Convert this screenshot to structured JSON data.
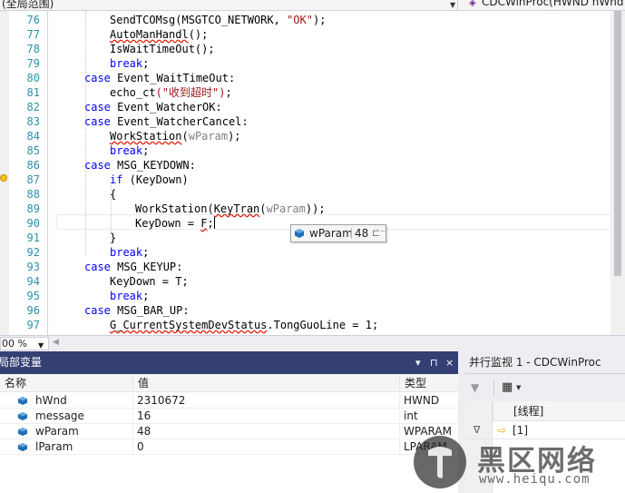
{
  "scope_bar": {
    "left": "(全局范围)",
    "right": "CDCWinProc(HWND hWnd"
  },
  "code_lines": [
    {
      "n": "76"
    },
    {
      "n": "77"
    },
    {
      "n": "78"
    },
    {
      "n": "79"
    },
    {
      "n": "80"
    },
    {
      "n": "81"
    },
    {
      "n": "82"
    },
    {
      "n": "83"
    },
    {
      "n": "84"
    },
    {
      "n": "85"
    },
    {
      "n": "86"
    },
    {
      "n": "87"
    },
    {
      "n": "88"
    },
    {
      "n": "89"
    },
    {
      "n": "90"
    },
    {
      "n": "91"
    },
    {
      "n": "92"
    },
    {
      "n": "93"
    },
    {
      "n": "94"
    },
    {
      "n": "95"
    },
    {
      "n": "96"
    },
    {
      "n": "97"
    }
  ],
  "code": {
    "l76_fn": "SendTCOMsg",
    "l76_args_a": "(MSGTCO_NETWORK, ",
    "l76_str": "\"OK\"",
    "l76_end": ");",
    "l77_fn": "AutoManHandl",
    "l77_end": "();",
    "l78": "IsWaitTimeOut();",
    "l79_kw": "break",
    "l79_end": ";",
    "l80_kw": "case",
    "l80_rest": " Event_WaitTimeOut:",
    "l81_fn": "echo_ct",
    "l81_str": "(\"收到超时\")",
    "l81_end": ";",
    "l82_kw": "case",
    "l82_rest": " Event_WatcherOK:",
    "l83_kw": "case",
    "l83_rest": " Event_WatcherCancel:",
    "l84_fn": "WorkStation",
    "l84_open": "(",
    "l84_param": "wParam",
    "l84_end": ");",
    "l85_kw": "break",
    "l85_end": ";",
    "l86_kw": "case",
    "l86_rest": " MSG_KEYDOWN:",
    "l87_kw": "if",
    "l87_rest": " (KeyDown)",
    "l88": "{",
    "l89_a": "WorkStation(",
    "l89_fn": "KeyTran",
    "l89_open": "(",
    "l89_param": "wParam",
    "l89_end": "));",
    "l90_a": "KeyDown = ",
    "l90_val": "F",
    "l90_end": ";",
    "l91": "}",
    "l92_kw": "break",
    "l92_end": ";",
    "l93_kw": "case",
    "l93_rest": " MSG_KEYUP:",
    "l94": "KeyDown = T;",
    "l95_kw": "break",
    "l95_end": ";",
    "l96_kw": "case",
    "l96_rest": " MSG_BAR_UP:",
    "l97_var": "G_CurrentSystemDevStatus",
    "l97_rest": ".TongGuoLine = 1;"
  },
  "datatip": {
    "name": "wParam",
    "value": "48",
    "pin_icon": "pin-icon"
  },
  "zoom": {
    "value": "00 %"
  },
  "locals": {
    "title": "局部变量",
    "title_btns": [
      "▾",
      "⊓",
      "×"
    ],
    "columns": [
      "名称",
      "值",
      "类型"
    ],
    "rows": [
      {
        "name": "hWnd",
        "value": "2310672",
        "type": "HWND"
      },
      {
        "name": "message",
        "value": "16",
        "type": "int"
      },
      {
        "name": "wParam",
        "value": "48",
        "type": "WPARAM"
      },
      {
        "name": "lParam",
        "value": "0",
        "type": "LPARAM"
      }
    ]
  },
  "parallel_watch": {
    "title": "并行监视 1 - CDCWinProc",
    "column_header": "[线程]",
    "rows": [
      {
        "thread": "[1]"
      }
    ]
  },
  "watermark": {
    "title": "黑区网络",
    "url": "www.heiqu.com"
  },
  "colors": {
    "keyword": "#0000ff",
    "string": "#a31515",
    "line_number": "#2b91af",
    "tool_title_active": "#343f73",
    "squiggle": "#e51400"
  }
}
